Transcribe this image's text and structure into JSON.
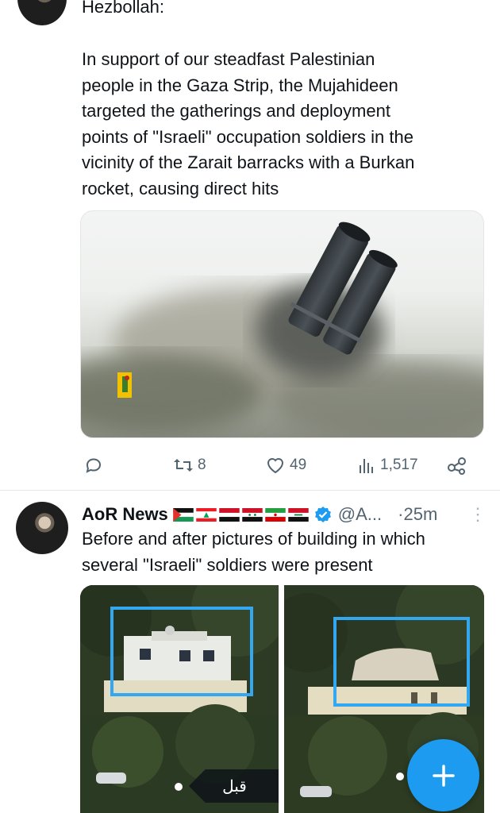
{
  "post1": {
    "author_line": "Hezbollah:",
    "body": "In support of our steadfast Palestinian\npeople in the Gaza Strip, the Mujahideen\ntargeted the gatherings and deployment\npoints of \"Israeli\" occupation soldiers in the\nvicinity of the Zarait barracks with a Burkan\nrocket, causing direct hits",
    "media_icon": "rocket-launcher-image",
    "actions": {
      "reply_icon": "reply-icon",
      "repost_icon": "repost-icon",
      "repost_count": "8",
      "like_icon": "heart-icon",
      "like_count": "49",
      "views_icon": "views-icon",
      "views_count": "1,517",
      "share_icon": "share-icon"
    }
  },
  "post2": {
    "name": "AoR News",
    "handle": "@A...",
    "time": "·25m",
    "more": "⋮",
    "flags": [
      "palestine-flag",
      "lebanon-flag",
      "yemen-flag",
      "syria-flag",
      "iran-flag",
      "iraq-flag"
    ],
    "body": "Before and after pictures of building in which\nseveral \"Israeli\" soldiers were present",
    "media_left_badge": "قبل",
    "verified_icon": "verified-badge-icon"
  },
  "fab": {
    "icon": "compose-plus-icon",
    "label": "+"
  },
  "colors": {
    "accent": "#1d9bf0",
    "secondary_text": "#536471",
    "highlight_box": "#33a7ef"
  }
}
